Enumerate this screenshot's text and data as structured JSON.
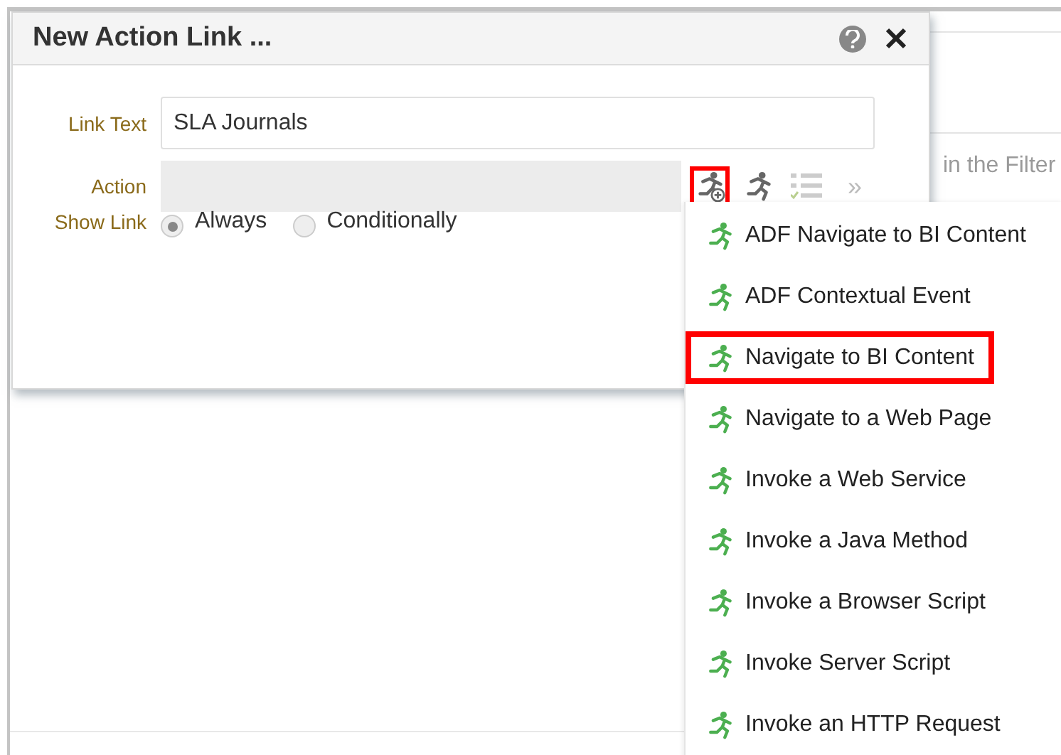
{
  "background": {
    "text": "in the Filter"
  },
  "dialog": {
    "title": "New Action Link ...",
    "link_text": {
      "label": "Link Text",
      "value": "SLA Journals"
    },
    "action": {
      "label": "Action"
    },
    "action_tools": [
      {
        "kind": "add-action",
        "highlighted": true
      },
      {
        "kind": "action",
        "highlighted": false
      },
      {
        "kind": "conditions",
        "highlighted": false
      },
      {
        "kind": "more",
        "label": "»",
        "highlighted": false
      }
    ],
    "show_link": {
      "label": "Show Link",
      "options": [
        {
          "label": "Always",
          "selected": true
        },
        {
          "label": "Conditionally",
          "selected": false
        }
      ]
    }
  },
  "menu": {
    "items": [
      {
        "label": "ADF Navigate to BI Content",
        "highlighted": false
      },
      {
        "label": "ADF Contextual Event",
        "highlighted": false
      },
      {
        "label": "Navigate to BI Content",
        "highlighted": true
      },
      {
        "label": "Navigate to a Web Page",
        "highlighted": false
      },
      {
        "label": "Invoke a Web Service",
        "highlighted": false
      },
      {
        "label": "Invoke a Java Method",
        "highlighted": false
      },
      {
        "label": "Invoke a Browser Script",
        "highlighted": false
      },
      {
        "label": "Invoke Server Script",
        "highlighted": false
      },
      {
        "label": "Invoke an HTTP Request",
        "highlighted": false
      }
    ]
  }
}
